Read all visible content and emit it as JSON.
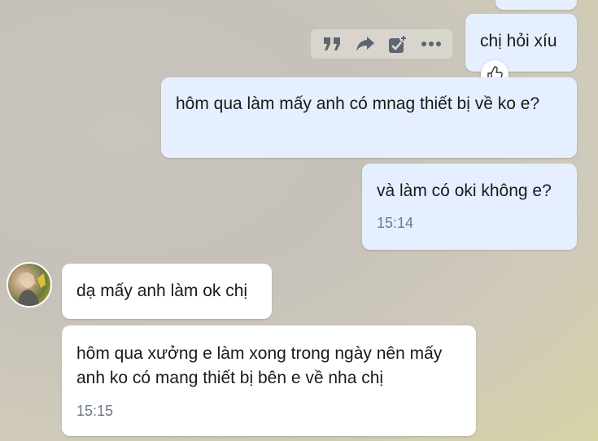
{
  "toolbar": {
    "icons": [
      "quote-icon",
      "forward-icon",
      "add-task-icon",
      "more-icon"
    ]
  },
  "reaction": {
    "icon": "thumbs-up-icon"
  },
  "messages": {
    "m0": {
      "text": "chị hỏi xíu"
    },
    "m1": {
      "text": "hôm qua làm mấy anh có mnag thiết bị về ko e?"
    },
    "m2": {
      "text": "và làm có oki không e?",
      "time": "15:14"
    },
    "m3": {
      "text": "dạ mấy anh làm ok chị"
    },
    "m4": {
      "text": "hôm qua xưởng e làm xong trong ngày nên mấy anh ko có mang thiết bị bên e về nha chị",
      "time": "15:15"
    }
  },
  "colors": {
    "outgoing_bubble": "#e5efff",
    "incoming_bubble": "#ffffff",
    "timestamp": "#6f7a86",
    "icon": "#5b6670"
  }
}
